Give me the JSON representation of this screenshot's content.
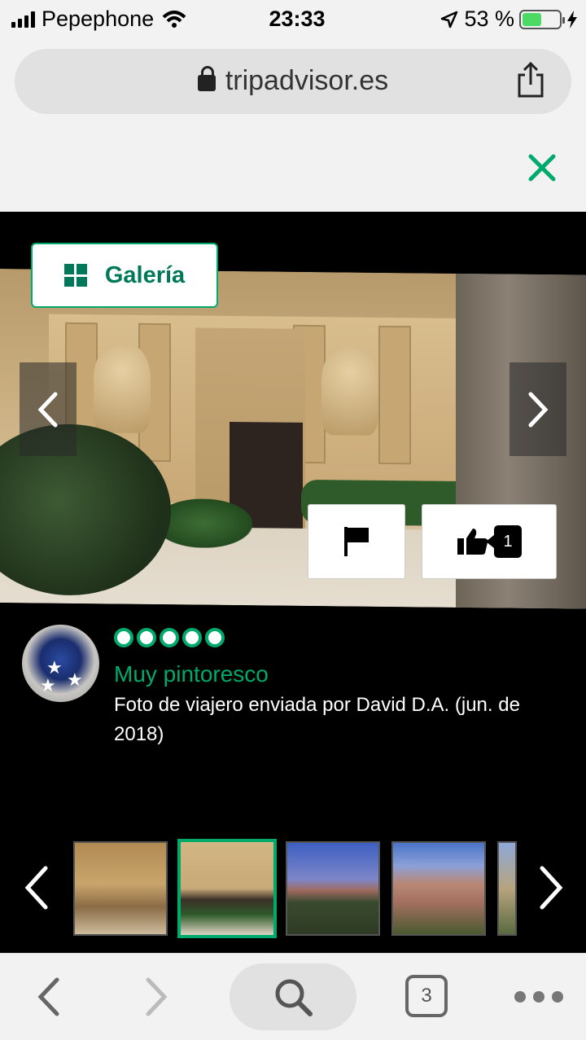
{
  "status_bar": {
    "carrier": "Pepephone",
    "time": "23:33",
    "battery_percent": "53 %",
    "battery_level": 0.53
  },
  "browser": {
    "url": "tripadvisor.es",
    "tab_count": "3"
  },
  "viewer": {
    "gallery_label": "Galería",
    "likes_count": "1"
  },
  "review": {
    "rating_bubbles": 5,
    "title": "Muy pintoresco",
    "meta": "Foto de viajero enviada por David D.A. (jun. de 2018)"
  },
  "colors": {
    "accent": "#00aa6c",
    "accent_dark": "#00785a",
    "viewer_bg": "#000000"
  },
  "icons": [
    "signal-icon",
    "wifi-icon",
    "location-icon",
    "battery-icon",
    "charging-icon",
    "lock-icon",
    "share-icon",
    "close-icon",
    "gallery-grid-icon",
    "chevron-left-icon",
    "chevron-right-icon",
    "flag-icon",
    "thumbs-up-icon",
    "search-icon",
    "tabs-icon",
    "more-icon"
  ]
}
